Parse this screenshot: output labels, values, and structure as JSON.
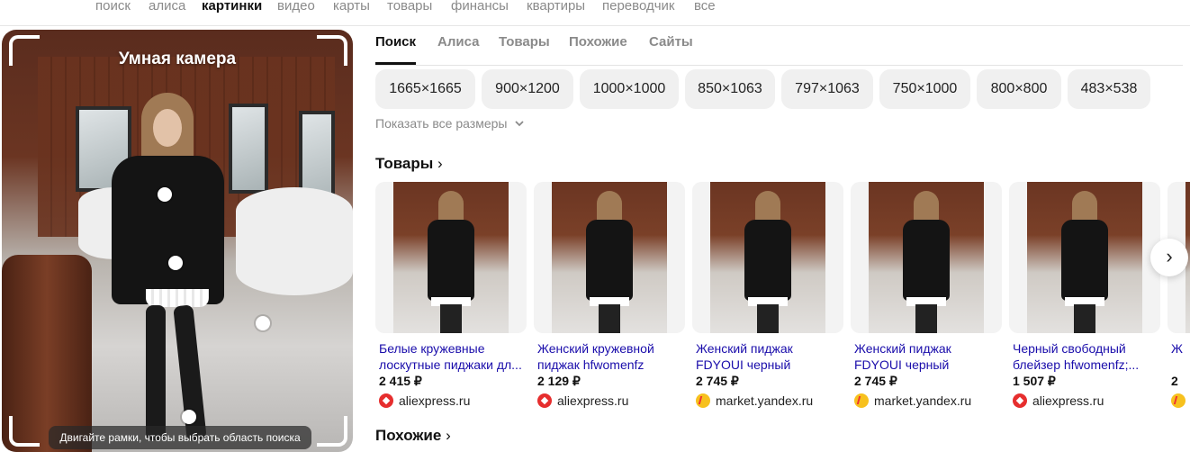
{
  "topnav": {
    "items": [
      "поиск",
      "алиса",
      "картинки",
      "видео",
      "карты",
      "товары",
      "финансы",
      "квартиры",
      "переводчик",
      "все"
    ],
    "active": "картинки"
  },
  "preview": {
    "title": "Умная камера",
    "hint": "Двигайте рамки, чтобы выбрать область поиска"
  },
  "tabs": [
    "Поиск",
    "Алиса",
    "Товары",
    "Похожие",
    "Сайты"
  ],
  "sizes": [
    "1665×1665",
    "900×1200",
    "1000×1000",
    "850×1063",
    "797×1063",
    "750×1000",
    "800×800",
    "483×538"
  ],
  "show_all_sizes": "Показать все размеры",
  "products_section": {
    "title": "Товары",
    "chevron": "›"
  },
  "products": [
    {
      "name": "Белые кружевные лоскутные пиджаки дл...",
      "price": "2 415 ₽",
      "shop": "aliexpress.ru",
      "shop_icon": "aliexpress-icon"
    },
    {
      "name": "Женский кружевной пиджак hfwomenfz",
      "price": "2 129 ₽",
      "shop": "aliexpress.ru",
      "shop_icon": "aliexpress-icon"
    },
    {
      "name": "Женский пиджак FDYOUI черный",
      "price": "2 745 ₽",
      "shop": "market.yandex.ru",
      "shop_icon": "yandex-market-icon"
    },
    {
      "name": "Женский пиджак FDYOUI черный",
      "price": "2 745 ₽",
      "shop": "market.yandex.ru",
      "shop_icon": "yandex-market-icon"
    },
    {
      "name": "Черный свободный блейзер hfwomenfz;...",
      "price": "1 507 ₽",
      "shop": "aliexpress.ru",
      "shop_icon": "aliexpress-icon"
    }
  ],
  "partial_card": {
    "name": "Ж",
    "price": "2"
  },
  "similar_section": {
    "title": "Похожие",
    "chevron": "›"
  },
  "next_button": "›"
}
